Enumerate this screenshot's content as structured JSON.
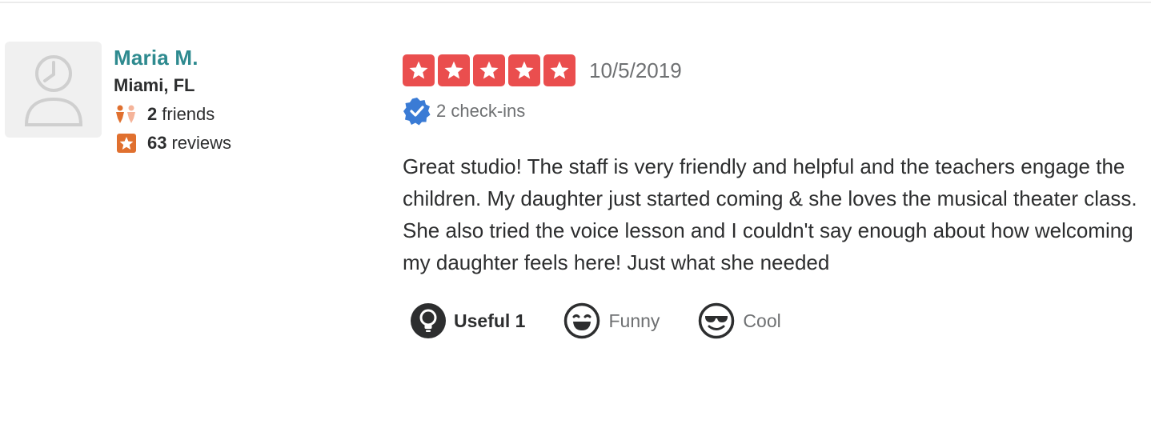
{
  "user": {
    "name": "Maria M.",
    "location": "Miami, FL",
    "friends_count": "2",
    "friends_label": "friends",
    "reviews_count": "63",
    "reviews_label": "reviews"
  },
  "review": {
    "rating": 5,
    "date": "10/5/2019",
    "checkins": "2 check-ins",
    "text": "Great studio! The staff is very friendly and helpful and the teachers engage the children. My daughter just started coming & she loves the musical theater class. She also tried the voice lesson and I couldn't say enough about how welcoming my daughter feels here! Just what she needed"
  },
  "reactions": {
    "useful": "Useful 1",
    "funny": "Funny",
    "cool": "Cool"
  },
  "colors": {
    "star_red": "#ea4e4e",
    "name_teal": "#2e8a8f",
    "checkin_blue": "#3a7bd5",
    "icon_orange": "#e0702f"
  },
  "icons": {
    "avatar": "user-silhouette-icon",
    "friends": "friends-icon",
    "reviews": "review-star-icon",
    "checkin": "verified-badge-icon",
    "useful": "lightbulb-icon",
    "funny": "laughing-face-icon",
    "cool": "sunglasses-face-icon"
  }
}
